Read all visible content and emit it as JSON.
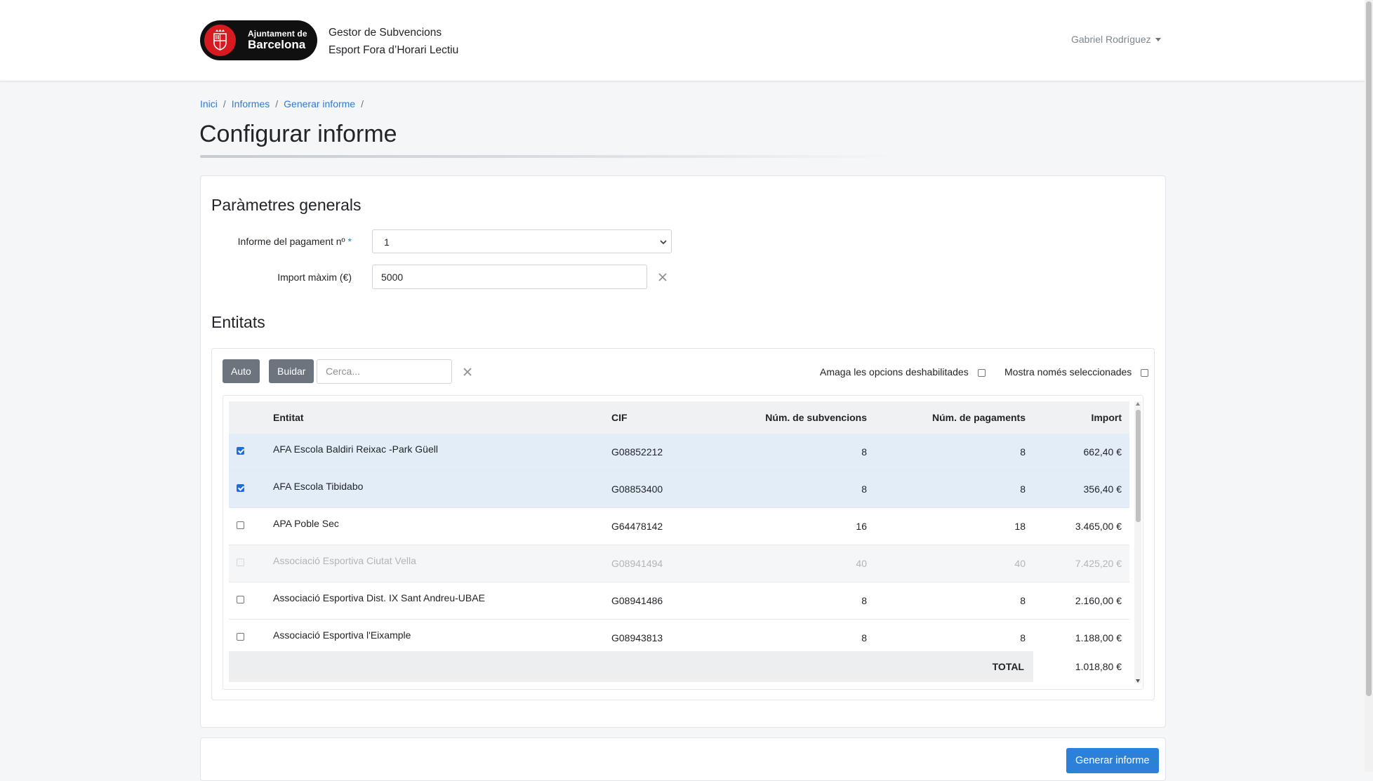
{
  "header": {
    "logo": {
      "line1": "Ajuntament de",
      "line2": "Barcelona"
    },
    "app_title_line1": "Gestor de Subvencions",
    "app_title_line2": "Esport Fora d’Horari Lectiu",
    "user_name": "Gabriel Rodríguez"
  },
  "breadcrumb": [
    {
      "label": "Inici"
    },
    {
      "label": "Informes"
    },
    {
      "label": "Generar informe"
    }
  ],
  "breadcrumb_sep": "/",
  "page_title": "Configurar informe",
  "general": {
    "title": "Paràmetres generals",
    "payment_label": "Informe del pagament nº",
    "payment_required_mark": "*",
    "payment_value": "1",
    "max_import_label": "Import màxim (€)",
    "max_import_value": "5000"
  },
  "entities": {
    "title": "Entitats",
    "auto_button": "Auto",
    "clear_button": "Buidar",
    "search_placeholder": "Cerca...",
    "hide_disabled_label": "Amaga les opcions deshabilitades",
    "hide_disabled_checked": false,
    "only_selected_label": "Mostra només seleccionades",
    "only_selected_checked": false,
    "columns": {
      "entity": "Entitat",
      "cif": "CIF",
      "num_subsidies": "Núm. de subvencions",
      "num_payments": "Núm. de pagaments",
      "import": "Import"
    },
    "rows": [
      {
        "name": "AFA Escola Baldiri Reixac -Park Güell",
        "cif": "G08852212",
        "num_subsidies": "8",
        "num_payments": "8",
        "import": "662,40 €",
        "checked": true,
        "disabled": false
      },
      {
        "name": "AFA Escola Tibidabo",
        "cif": "G08853400",
        "num_subsidies": "8",
        "num_payments": "8",
        "import": "356,40 €",
        "checked": true,
        "disabled": false
      },
      {
        "name": "APA Poble Sec",
        "cif": "G64478142",
        "num_subsidies": "16",
        "num_payments": "18",
        "import": "3.465,00 €",
        "checked": false,
        "disabled": false
      },
      {
        "name": "Associació Esportiva Ciutat Vella",
        "cif": "G08941494",
        "num_subsidies": "40",
        "num_payments": "40",
        "import": "7.425,20 €",
        "checked": false,
        "disabled": true
      },
      {
        "name": "Associació Esportiva Dist. IX Sant Andreu-UBAE",
        "cif": "G08941486",
        "num_subsidies": "8",
        "num_payments": "8",
        "import": "2.160,00 €",
        "checked": false,
        "disabled": false
      },
      {
        "name": "Associació Esportiva l'Eixample",
        "cif": "G08943813",
        "num_subsidies": "8",
        "num_payments": "8",
        "import": "1.188,00 €",
        "checked": false,
        "disabled": false
      }
    ],
    "total_label": "TOTAL",
    "total_value": "1.018,80 €"
  },
  "generate_button": "Generar informe",
  "colors": {
    "primary": "#2a81d7",
    "link": "#2c7cd6",
    "secondary_button": "#6c757d",
    "selected_row": "#e2edf8",
    "logo_red": "#d71920"
  }
}
